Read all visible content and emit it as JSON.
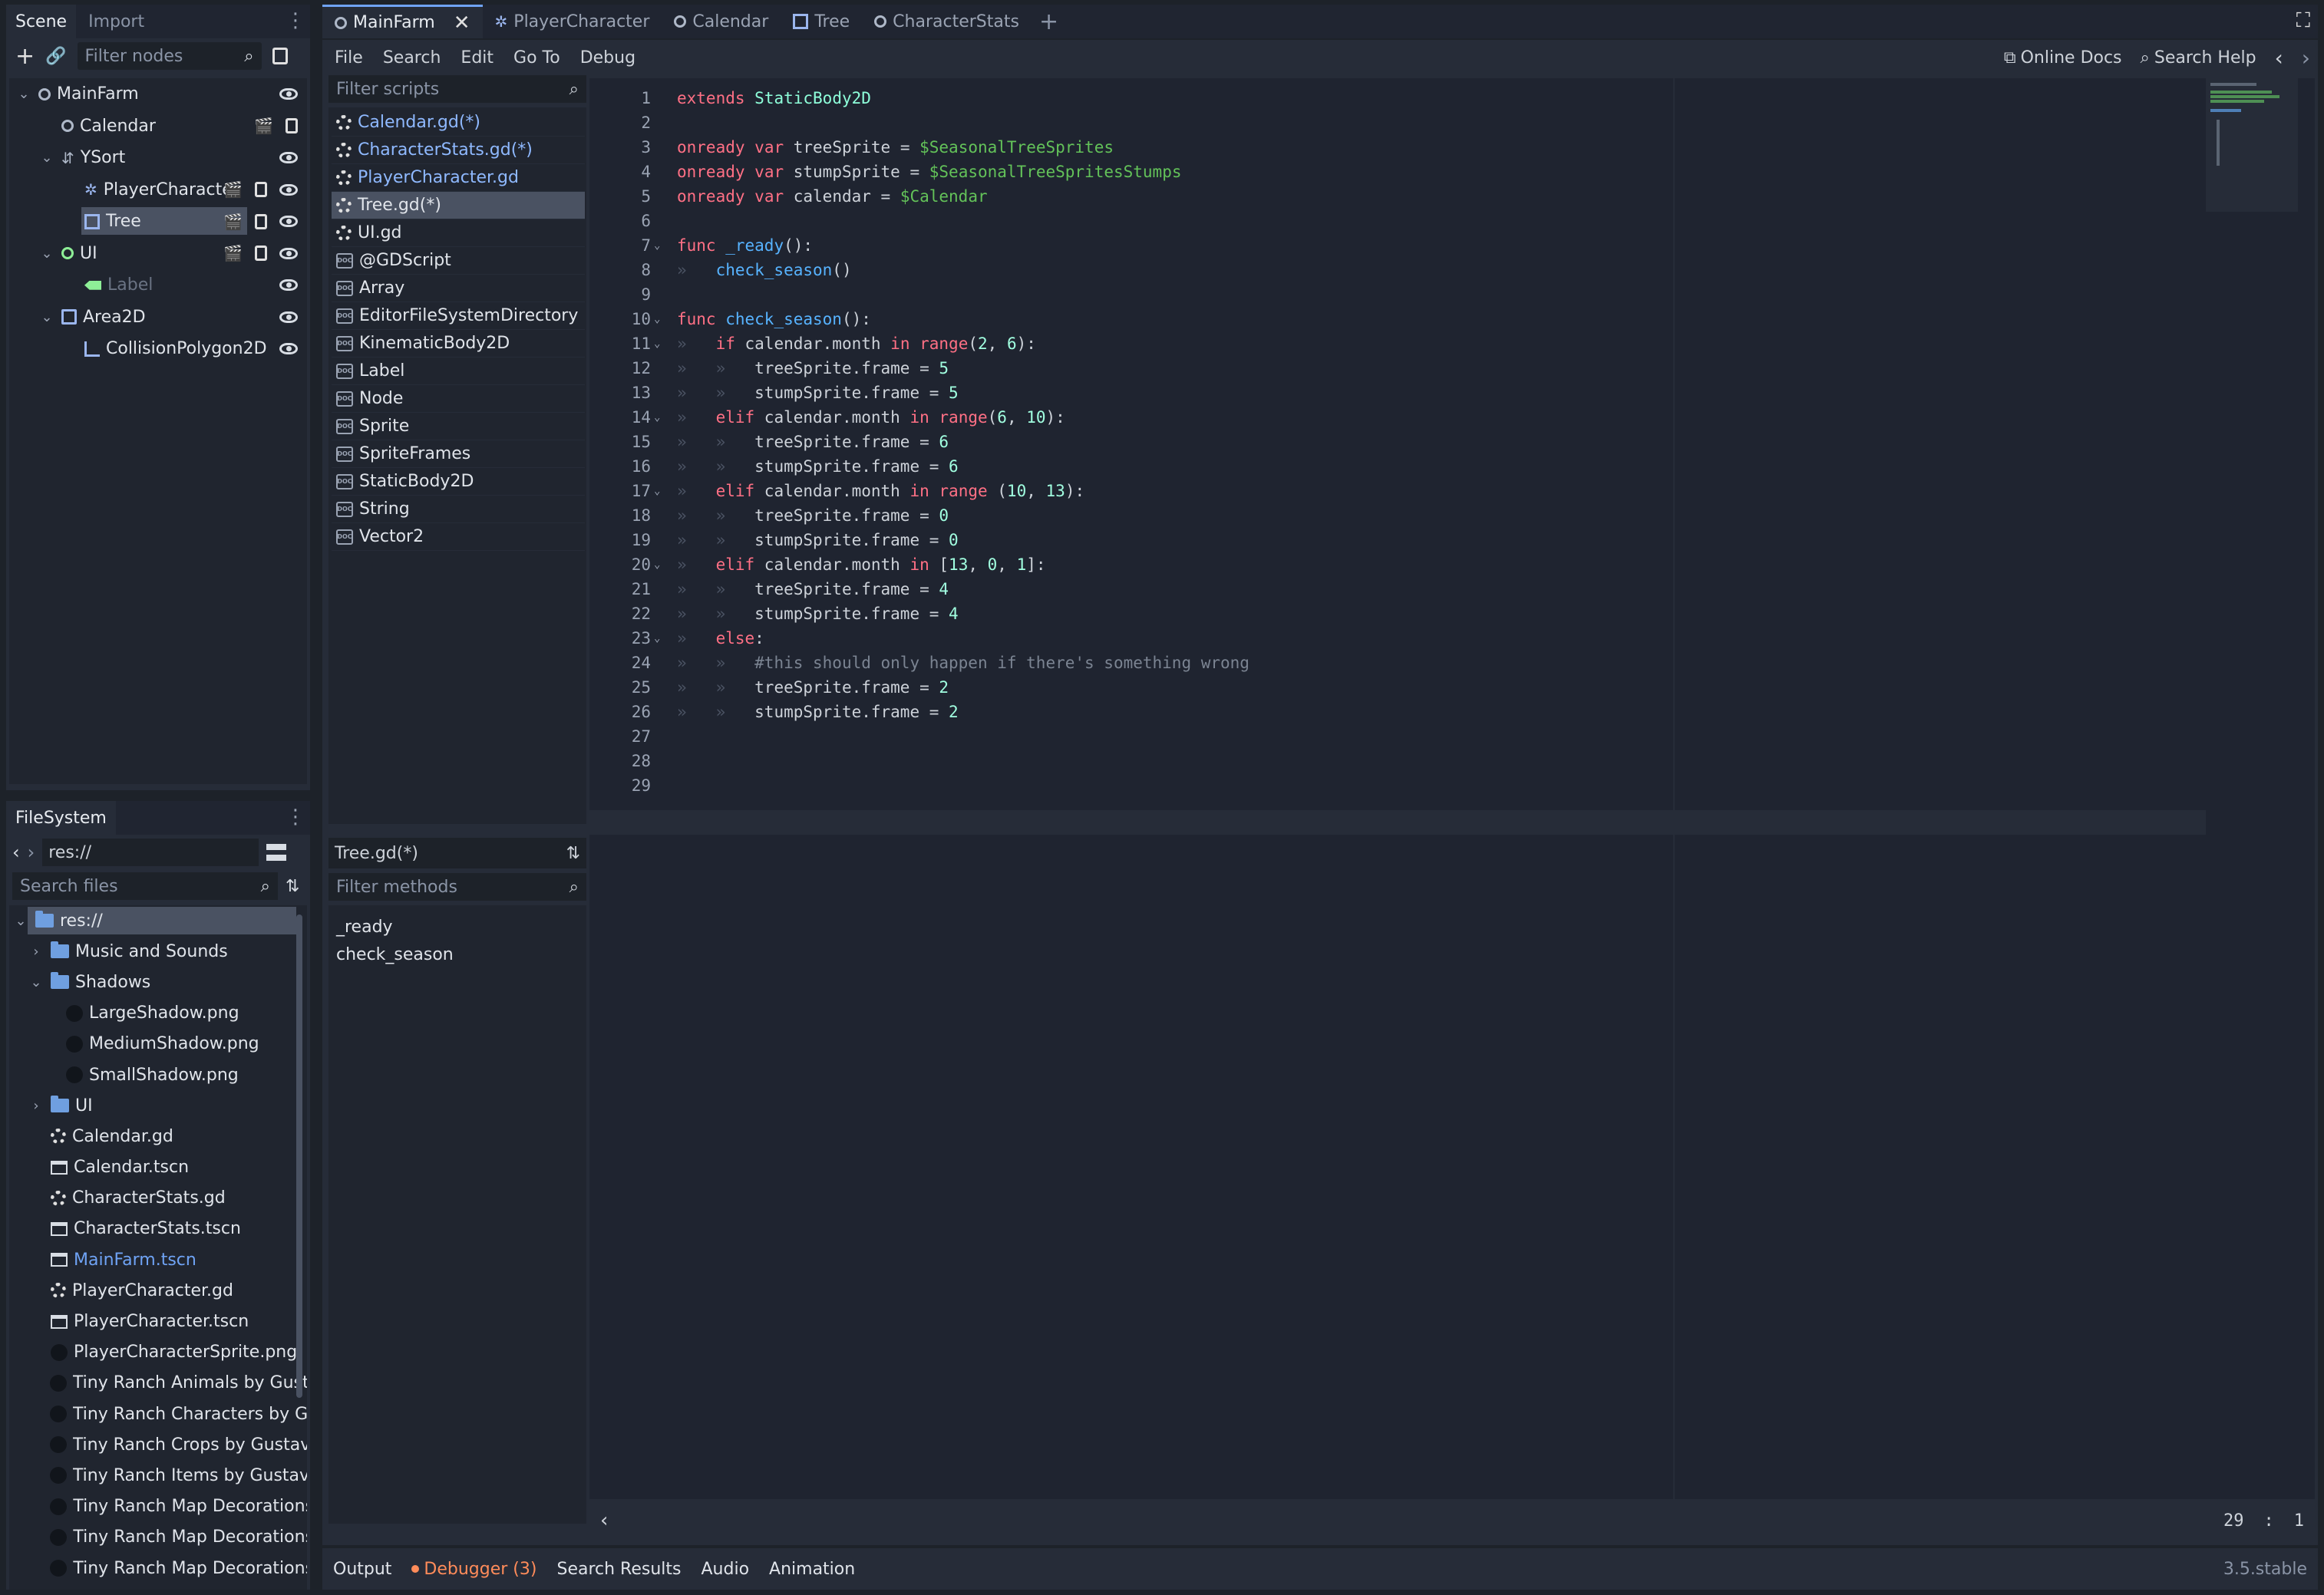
{
  "scene_dock": {
    "tabs": [
      "Scene",
      "Import"
    ],
    "filter_placeholder": "Filter nodes",
    "nodes": [
      {
        "name": "MainFarm",
        "depth": 0,
        "icon": "node2d-icon"
      },
      {
        "name": "Calendar",
        "depth": 1,
        "icon": "node2d-icon"
      },
      {
        "name": "YSort",
        "depth": 1,
        "icon": "ysort-icon"
      },
      {
        "name": "PlayerCharacter",
        "depth": 2,
        "icon": "kinematic-body-icon"
      },
      {
        "name": "Tree",
        "depth": 2,
        "icon": "static-body-icon"
      },
      {
        "name": "UI",
        "depth": 1,
        "icon": "control-icon"
      },
      {
        "name": "Label",
        "depth": 2,
        "icon": "label-icon"
      },
      {
        "name": "Area2D",
        "depth": 1,
        "icon": "area2d-icon"
      },
      {
        "name": "CollisionPolygon2D",
        "depth": 2,
        "icon": "collision-polygon-icon"
      }
    ]
  },
  "filesystem": {
    "title": "FileSystem",
    "path": "res://",
    "search_placeholder": "Search files",
    "items": [
      {
        "name": "res://",
        "depth": 0,
        "kind": "folder"
      },
      {
        "name": "Music and Sounds",
        "depth": 1,
        "kind": "folder"
      },
      {
        "name": "Shadows",
        "depth": 1,
        "kind": "folder"
      },
      {
        "name": "LargeShadow.png",
        "depth": 2,
        "kind": "image"
      },
      {
        "name": "MediumShadow.png",
        "depth": 2,
        "kind": "image"
      },
      {
        "name": "SmallShadow.png",
        "depth": 2,
        "kind": "image"
      },
      {
        "name": "UI",
        "depth": 1,
        "kind": "folder"
      },
      {
        "name": "Calendar.gd",
        "depth": 1,
        "kind": "script"
      },
      {
        "name": "Calendar.tscn",
        "depth": 1,
        "kind": "scene"
      },
      {
        "name": "CharacterStats.gd",
        "depth": 1,
        "kind": "script"
      },
      {
        "name": "CharacterStats.tscn",
        "depth": 1,
        "kind": "scene"
      },
      {
        "name": "MainFarm.tscn",
        "depth": 1,
        "kind": "scene"
      },
      {
        "name": "PlayerCharacter.gd",
        "depth": 1,
        "kind": "script"
      },
      {
        "name": "PlayerCharacter.tscn",
        "depth": 1,
        "kind": "scene"
      },
      {
        "name": "PlayerCharacterSprite.png",
        "depth": 1,
        "kind": "image"
      },
      {
        "name": "Tiny Ranch Animals by Gusta",
        "depth": 1,
        "kind": "image"
      },
      {
        "name": "Tiny Ranch Characters by Gu",
        "depth": 1,
        "kind": "image"
      },
      {
        "name": "Tiny Ranch Crops by Gustavo",
        "depth": 1,
        "kind": "image"
      },
      {
        "name": "Tiny Ranch Items by Gustavo",
        "depth": 1,
        "kind": "image"
      },
      {
        "name": "Tiny Ranch Map Decorations",
        "depth": 1,
        "kind": "image"
      },
      {
        "name": "Tiny Ranch Map Decorations",
        "depth": 1,
        "kind": "image"
      },
      {
        "name": "Tiny Ranch Map Decorations",
        "depth": 1,
        "kind": "image"
      }
    ]
  },
  "editor_tabs": [
    "MainFarm",
    "PlayerCharacter",
    "Calendar",
    "Tree",
    "CharacterStats"
  ],
  "menu": [
    "File",
    "Search",
    "Edit",
    "Go To",
    "Debug"
  ],
  "help": {
    "online_docs": "Online Docs",
    "search_help": "Search Help"
  },
  "scripts": {
    "filter_placeholder": "Filter scripts",
    "items": [
      {
        "name": "Calendar.gd(*)",
        "kind": "script"
      },
      {
        "name": "CharacterStats.gd(*)",
        "kind": "script"
      },
      {
        "name": "PlayerCharacter.gd",
        "kind": "script"
      },
      {
        "name": "Tree.gd(*)",
        "kind": "script"
      },
      {
        "name": "UI.gd",
        "kind": "script"
      },
      {
        "name": "@GDScript",
        "kind": "doc"
      },
      {
        "name": "Array",
        "kind": "doc"
      },
      {
        "name": "EditorFileSystemDirectory",
        "kind": "doc"
      },
      {
        "name": "KinematicBody2D",
        "kind": "doc"
      },
      {
        "name": "Label",
        "kind": "doc"
      },
      {
        "name": "Node",
        "kind": "doc"
      },
      {
        "name": "Sprite",
        "kind": "doc"
      },
      {
        "name": "SpriteFrames",
        "kind": "doc"
      },
      {
        "name": "StaticBody2D",
        "kind": "doc"
      },
      {
        "name": "String",
        "kind": "doc"
      },
      {
        "name": "Vector2",
        "kind": "doc"
      }
    ],
    "current": "Tree.gd(*)",
    "methods_placeholder": "Filter methods",
    "methods": [
      "_ready",
      "check_season"
    ]
  },
  "code": {
    "lines": [
      [
        [
          "kw",
          "extends"
        ],
        [
          "plain",
          " "
        ],
        [
          "cls",
          "StaticBody2D"
        ]
      ],
      [],
      [
        [
          "kw",
          "onready"
        ],
        [
          "plain",
          " "
        ],
        [
          "kw",
          "var"
        ],
        [
          "plain",
          " treeSprite = "
        ],
        [
          "node",
          "$SeasonalTreeSprites"
        ]
      ],
      [
        [
          "kw",
          "onready"
        ],
        [
          "plain",
          " "
        ],
        [
          "kw",
          "var"
        ],
        [
          "plain",
          " stumpSprite = "
        ],
        [
          "node",
          "$SeasonalTreeSpritesStumps"
        ]
      ],
      [
        [
          "kw",
          "onready"
        ],
        [
          "plain",
          " "
        ],
        [
          "kw",
          "var"
        ],
        [
          "plain",
          " calendar = "
        ],
        [
          "node",
          "$Calendar"
        ]
      ],
      [],
      [
        [
          "kw",
          "func"
        ],
        [
          "plain",
          " "
        ],
        [
          "fn",
          "_ready"
        ],
        [
          "plain",
          "():"
        ]
      ],
      [
        [
          "tab",
          "»   "
        ],
        [
          "fn",
          "check_season"
        ],
        [
          "plain",
          "()"
        ]
      ],
      [],
      [
        [
          "kw",
          "func"
        ],
        [
          "plain",
          " "
        ],
        [
          "fn",
          "check_season"
        ],
        [
          "plain",
          "():"
        ]
      ],
      [
        [
          "tab",
          "»   "
        ],
        [
          "kw",
          "if"
        ],
        [
          "plain",
          " calendar.month "
        ],
        [
          "kw",
          "in"
        ],
        [
          "plain",
          " "
        ],
        [
          "kw",
          "range"
        ],
        [
          "plain",
          "("
        ],
        [
          "num",
          "2"
        ],
        [
          "plain",
          ", "
        ],
        [
          "num",
          "6"
        ],
        [
          "plain",
          "):"
        ]
      ],
      [
        [
          "tab",
          "»   »   "
        ],
        [
          "plain",
          "treeSprite.frame = "
        ],
        [
          "num",
          "5"
        ]
      ],
      [
        [
          "tab",
          "»   »   "
        ],
        [
          "plain",
          "stumpSprite.frame = "
        ],
        [
          "num",
          "5"
        ]
      ],
      [
        [
          "tab",
          "»   "
        ],
        [
          "kw",
          "elif"
        ],
        [
          "plain",
          " calendar.month "
        ],
        [
          "kw",
          "in"
        ],
        [
          "plain",
          " "
        ],
        [
          "kw",
          "range"
        ],
        [
          "plain",
          "("
        ],
        [
          "num",
          "6"
        ],
        [
          "plain",
          ", "
        ],
        [
          "num",
          "10"
        ],
        [
          "plain",
          "):"
        ]
      ],
      [
        [
          "tab",
          "»   »   "
        ],
        [
          "plain",
          "treeSprite.frame = "
        ],
        [
          "num",
          "6"
        ]
      ],
      [
        [
          "tab",
          "»   »   "
        ],
        [
          "plain",
          "stumpSprite.frame = "
        ],
        [
          "num",
          "6"
        ]
      ],
      [
        [
          "tab",
          "»   "
        ],
        [
          "kw",
          "elif"
        ],
        [
          "plain",
          " calendar.month "
        ],
        [
          "kw",
          "in"
        ],
        [
          "plain",
          " "
        ],
        [
          "kw",
          "range"
        ],
        [
          "plain",
          " ("
        ],
        [
          "num",
          "10"
        ],
        [
          "plain",
          ", "
        ],
        [
          "num",
          "13"
        ],
        [
          "plain",
          "):"
        ]
      ],
      [
        [
          "tab",
          "»   »   "
        ],
        [
          "plain",
          "treeSprite.frame = "
        ],
        [
          "num",
          "0"
        ]
      ],
      [
        [
          "tab",
          "»   »   "
        ],
        [
          "plain",
          "stumpSprite.frame = "
        ],
        [
          "num",
          "0"
        ]
      ],
      [
        [
          "tab",
          "»   "
        ],
        [
          "kw",
          "elif"
        ],
        [
          "plain",
          " calendar.month "
        ],
        [
          "kw",
          "in"
        ],
        [
          "plain",
          " ["
        ],
        [
          "num",
          "13"
        ],
        [
          "plain",
          ", "
        ],
        [
          "num",
          "0"
        ],
        [
          "plain",
          ", "
        ],
        [
          "num",
          "1"
        ],
        [
          "plain",
          "]:"
        ]
      ],
      [
        [
          "tab",
          "»   »   "
        ],
        [
          "plain",
          "treeSprite.frame = "
        ],
        [
          "num",
          "4"
        ]
      ],
      [
        [
          "tab",
          "»   »   "
        ],
        [
          "plain",
          "stumpSprite.frame = "
        ],
        [
          "num",
          "4"
        ]
      ],
      [
        [
          "tab",
          "»   "
        ],
        [
          "kw",
          "else"
        ],
        [
          "plain",
          ":"
        ]
      ],
      [
        [
          "tab",
          "»   »   "
        ],
        [
          "cm",
          "#this should only happen if there's something wrong"
        ]
      ],
      [
        [
          "tab",
          "»   »   "
        ],
        [
          "plain",
          "treeSprite.frame = "
        ],
        [
          "num",
          "2"
        ]
      ],
      [
        [
          "tab",
          "»   »   "
        ],
        [
          "plain",
          "stumpSprite.frame = "
        ],
        [
          "num",
          "2"
        ]
      ],
      [],
      [],
      []
    ],
    "fold_lines": [
      7,
      10,
      11,
      14,
      17,
      20,
      23
    ],
    "cursor_line": "29",
    "cursor_col": "1",
    "cursor_sep": ":"
  },
  "bottom_tabs": [
    "Output",
    "Debugger (3)",
    "Search Results",
    "Audio",
    "Animation"
  ],
  "version": "3.5.stable",
  "colors": {
    "accent": "#6fa3f5",
    "warning": "#ff8c5a"
  }
}
